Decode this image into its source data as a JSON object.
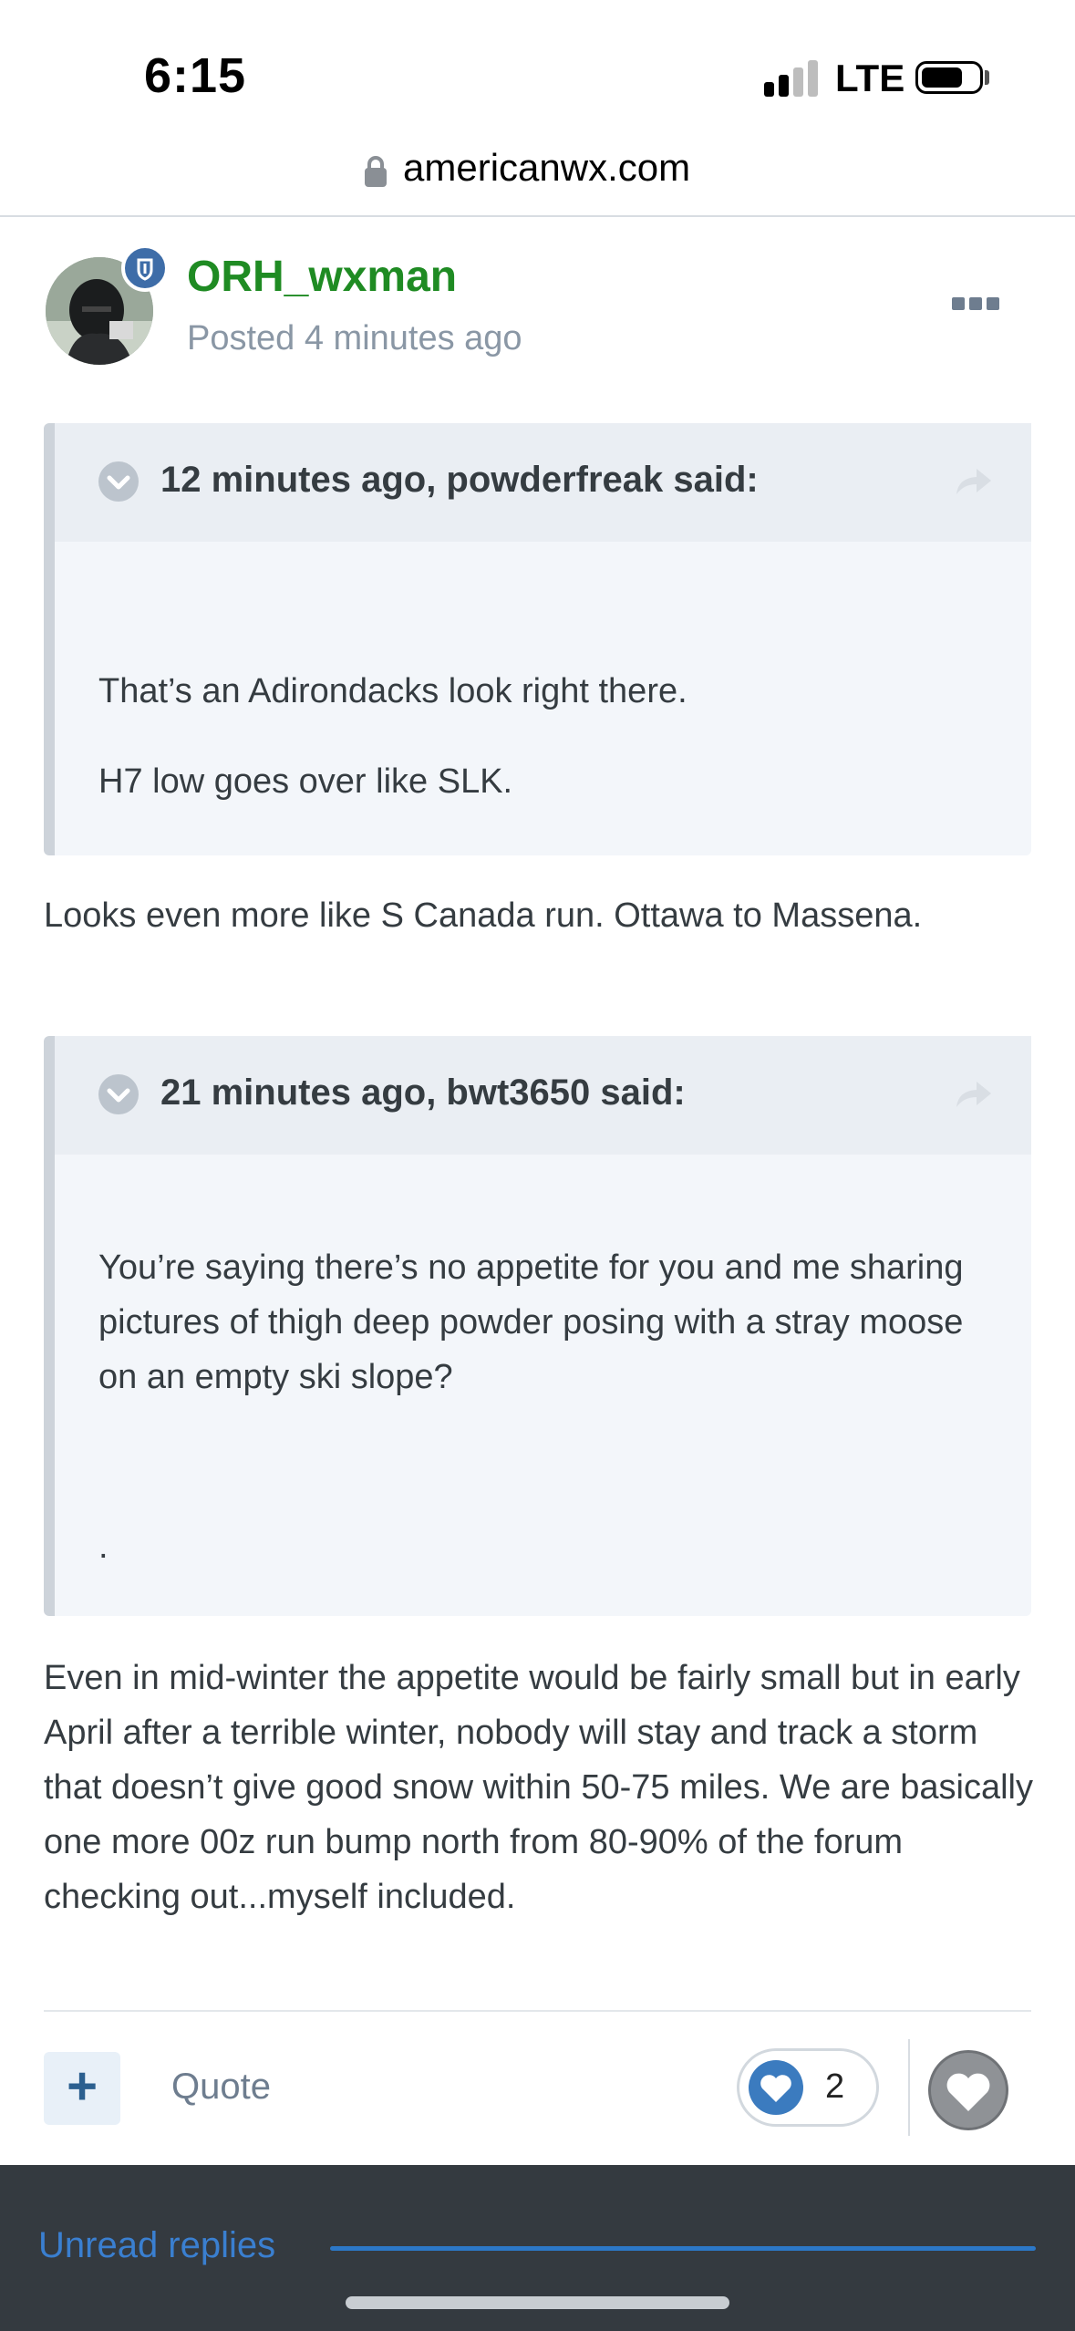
{
  "status_bar": {
    "time": "6:15",
    "network": "LTE",
    "signal_bars_filled": 2,
    "signal_bars_total": 4
  },
  "browser": {
    "url": "americanwx.com"
  },
  "post": {
    "author": "ORH_wxman",
    "posted": "Posted 4 minutes ago",
    "quotes": [
      {
        "citation": "12 minutes ago, powderfreak said:",
        "paragraphs": [
          "That’s an Adirondacks look right there.",
          "H7 low goes over like SLK."
        ]
      },
      {
        "citation": "21 minutes ago, bwt3650 said:",
        "paragraphs": [
          "You’re saying there’s no appetite for you and me sharing pictures of thigh deep powder posing with a stray moose on an empty ski slope?",
          "."
        ]
      }
    ],
    "replies": [
      "Looks even more like S Canada run. Ottawa to Massena.",
      "Even in mid-winter the appetite would be fairly small but in early April after a terrible winter, nobody will stay and track a storm that doesn’t give good snow within 50-75 miles. We are basically one more 00z run bump north from 80-90% of the forum checking out...myself included."
    ]
  },
  "footer": {
    "add_label": "+",
    "quote_label": "Quote",
    "reaction_count": "2"
  },
  "bottom_bar": {
    "unread_label": "Unread replies"
  },
  "colors": {
    "author": "#1f8b23",
    "accent": "#3b7bbf",
    "bottom_bar": "#343a40"
  }
}
